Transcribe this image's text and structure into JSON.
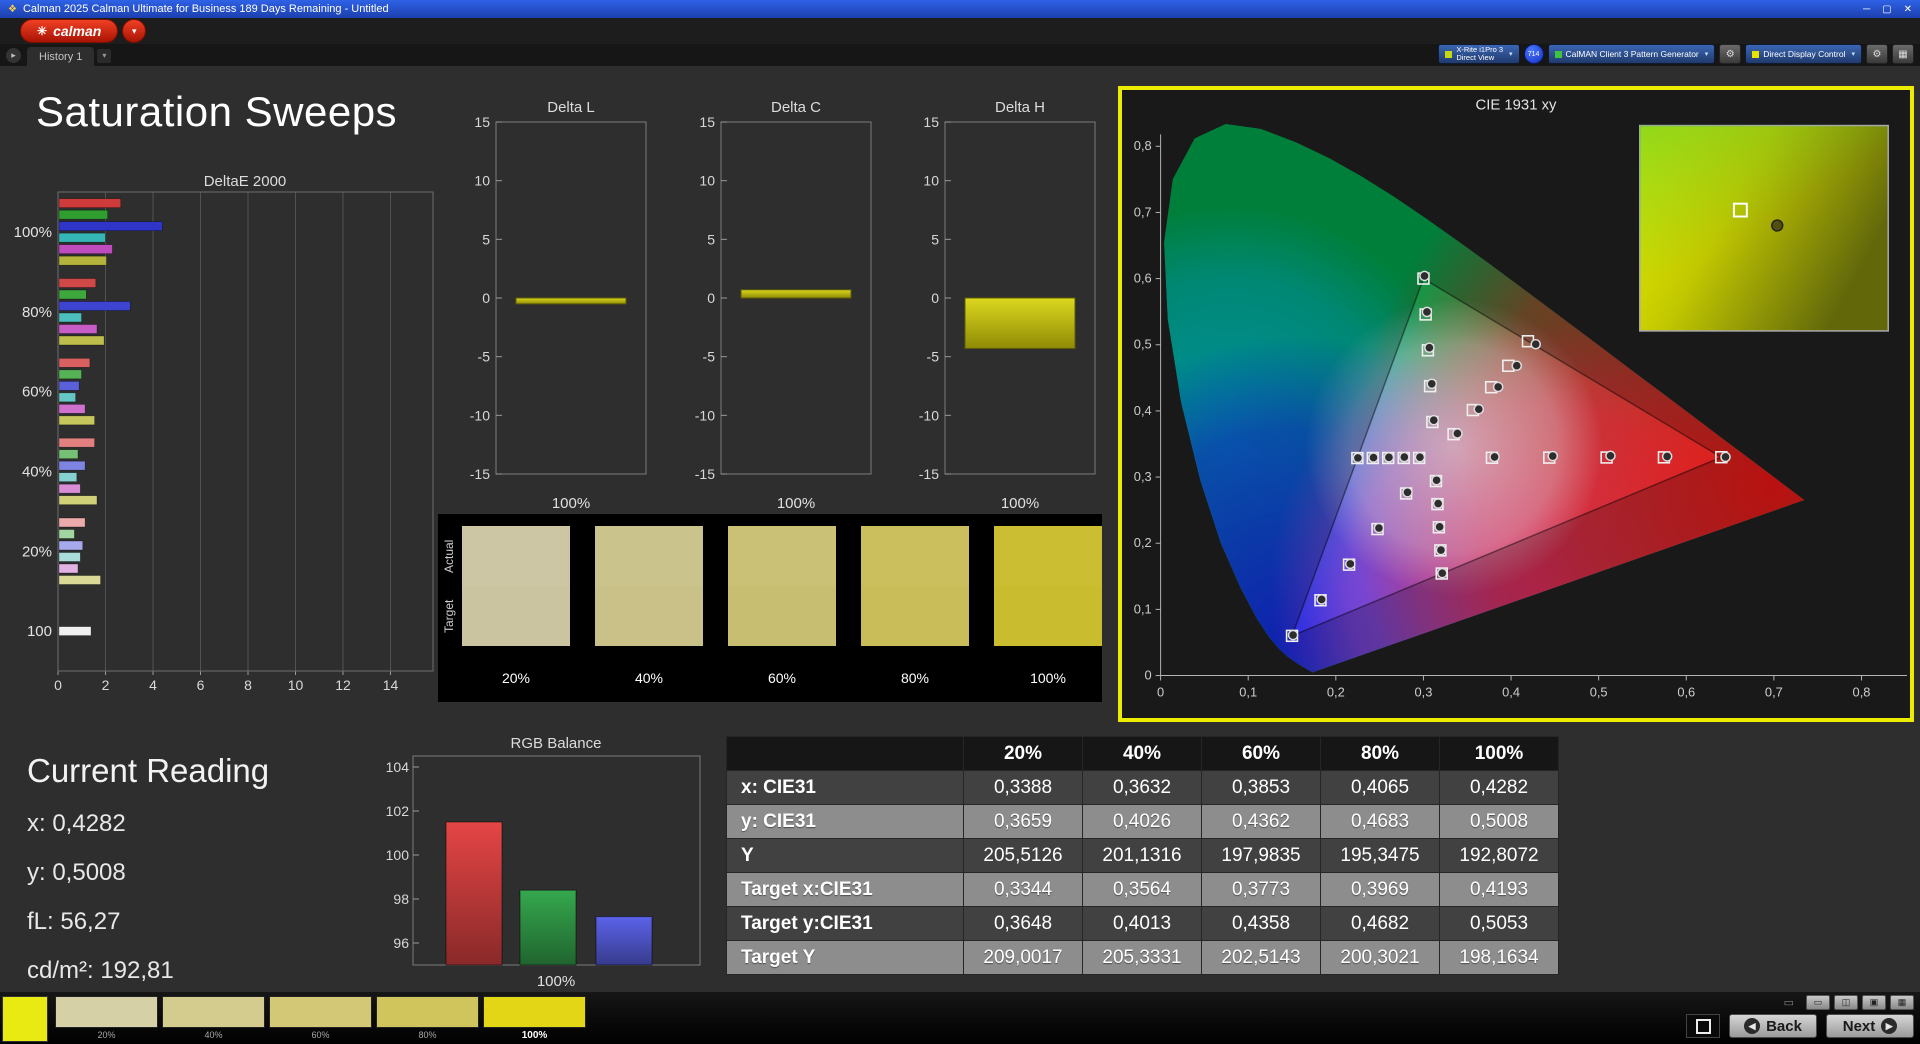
{
  "window": {
    "title": "Calman 2025 Calman Ultimate for Business 189 Days Remaining  - Untitled",
    "minimize": "─",
    "maximize": "▢",
    "close": "✕"
  },
  "logo": {
    "text": "calman",
    "icon": "✳",
    "menu_chevron": "▾"
  },
  "tabs": {
    "history": "History 1",
    "nav_forward": "▸",
    "dropdown": "▾"
  },
  "toolbar": {
    "meter_line1": "X-Rite i1Pro 3",
    "meter_line2": "Direct View",
    "badge": "714",
    "source": "CalMAN Client 3 Pattern Generator",
    "display": "Direct Display Control",
    "gear": "⚙",
    "dropdown": "▾",
    "layout": "▦",
    "meter_status_color": "#c6d80e",
    "pattern_status_color": "#3fc43f",
    "display_status_color": "#e8e400"
  },
  "page_title": "Saturation Sweeps",
  "current_reading": {
    "title": "Current Reading",
    "lines": [
      "x: 0,4282",
      "y: 0,5008",
      "fL: 56,27",
      "cd/m²: 192,81"
    ]
  },
  "swatch_panel": {
    "row_labels": [
      "Actual",
      "Target"
    ],
    "columns": [
      {
        "label": "20%",
        "actual": "#cdc6a4",
        "target": "#cbc4a0"
      },
      {
        "label": "40%",
        "actual": "#cbc38c",
        "target": "#c9c188"
      },
      {
        "label": "60%",
        "actual": "#cac076",
        "target": "#c8be72"
      },
      {
        "label": "80%",
        "actual": "#cabf5c",
        "target": "#c8bd58"
      },
      {
        "label": "100%",
        "actual": "#cbbe32",
        "target": "#c9bc2e"
      }
    ]
  },
  "table": {
    "col_headers": [
      "",
      "20%",
      "40%",
      "60%",
      "80%",
      "100%"
    ],
    "rows": [
      {
        "label": "x: CIE31",
        "values": [
          "0,3388",
          "0,3632",
          "0,3853",
          "0,4065",
          "0,4282"
        ]
      },
      {
        "label": "y: CIE31",
        "values": [
          "0,3659",
          "0,4026",
          "0,4362",
          "0,4683",
          "0,5008"
        ]
      },
      {
        "label": "Y",
        "values": [
          "205,5126",
          "201,1316",
          "197,9835",
          "195,3475",
          "192,8072"
        ]
      },
      {
        "label": "Target x:CIE31",
        "values": [
          "0,3344",
          "0,3564",
          "0,3773",
          "0,3969",
          "0,4193"
        ]
      },
      {
        "label": "Target y:CIE31",
        "values": [
          "0,3648",
          "0,4013",
          "0,4358",
          "0,4682",
          "0,5053"
        ]
      },
      {
        "label": "Target Y",
        "values": [
          "209,0017",
          "205,3331",
          "202,5143",
          "200,3021",
          "198,1634"
        ]
      }
    ]
  },
  "bottom_bar": {
    "current_color": "#e8ea12",
    "back": "Back",
    "next": "Next",
    "back_arrow": "◀",
    "next_arrow": "▶",
    "monitor": "▭",
    "mini_buttons": [
      "▭",
      "◫",
      "▣",
      "▦"
    ],
    "swatches": [
      {
        "label": "20%",
        "color": "#d6d0a6"
      },
      {
        "label": "40%",
        "color": "#d4cc8e"
      },
      {
        "label": "60%",
        "color": "#d2c876"
      },
      {
        "label": "80%",
        "color": "#d0c55c"
      },
      {
        "label": "100%",
        "color": "#e2d616"
      }
    ]
  },
  "colors": {
    "accent_yellow": "#ecec00",
    "logo_red": "#d42814",
    "titlebar_blue": "#2a55d4"
  },
  "chart_data": [
    {
      "id": "deltae2000",
      "type": "bar",
      "orientation": "horizontal",
      "title": "DeltaE 2000",
      "xlim": [
        0,
        15.8
      ],
      "xticks": [
        0,
        2,
        4,
        6,
        8,
        10,
        12,
        14
      ],
      "groups": [
        {
          "label": "100%",
          "bars": [
            {
              "color": "#cf3a3a",
              "value": 2.6
            },
            {
              "color": "#2f9e2f",
              "value": 2.05
            },
            {
              "color": "#2e35c8",
              "value": 4.35
            },
            {
              "color": "#35b6b6",
              "value": 1.95
            },
            {
              "color": "#bf4cbf",
              "value": 2.25
            },
            {
              "color": "#b4b43c",
              "value": 2.0
            }
          ]
        },
        {
          "label": "80%",
          "bars": [
            {
              "color": "#d14848",
              "value": 1.55
            },
            {
              "color": "#3ea83e",
              "value": 1.15
            },
            {
              "color": "#3d44d1",
              "value": 3.0
            },
            {
              "color": "#4cbebe",
              "value": 0.95
            },
            {
              "color": "#c75cc7",
              "value": 1.6
            },
            {
              "color": "#bebe4c",
              "value": 1.9
            }
          ]
        },
        {
          "label": "60%",
          "bars": [
            {
              "color": "#d96060",
              "value": 1.3
            },
            {
              "color": "#55b255",
              "value": 0.95
            },
            {
              "color": "#5a60d9",
              "value": 0.85
            },
            {
              "color": "#66c6c6",
              "value": 0.7
            },
            {
              "color": "#cf70cf",
              "value": 1.1
            },
            {
              "color": "#c6c65e",
              "value": 1.5
            }
          ]
        },
        {
          "label": "40%",
          "bars": [
            {
              "color": "#e28080",
              "value": 1.5
            },
            {
              "color": "#76c076",
              "value": 0.8
            },
            {
              "color": "#7e84e2",
              "value": 1.1
            },
            {
              "color": "#86d0d0",
              "value": 0.75
            },
            {
              "color": "#d78ed7",
              "value": 0.9
            },
            {
              "color": "#d0d078",
              "value": 1.6
            }
          ]
        },
        {
          "label": "20%",
          "bars": [
            {
              "color": "#ecaaaa",
              "value": 1.1
            },
            {
              "color": "#a2d4a2",
              "value": 0.65
            },
            {
              "color": "#a6aaec",
              "value": 1.0
            },
            {
              "color": "#aadcdc",
              "value": 0.9
            },
            {
              "color": "#e2b2e2",
              "value": 0.8
            },
            {
              "color": "#dada96",
              "value": 1.75
            }
          ]
        },
        {
          "label": "100",
          "bars": [
            {
              "color": "#f0f0f0",
              "value": 1.35
            }
          ]
        }
      ]
    },
    {
      "id": "deltaL",
      "type": "bar",
      "title": "Delta L",
      "xlabel": "100%",
      "ylim": [
        -15,
        15
      ],
      "yticks": [
        15,
        10,
        5,
        0,
        -5,
        -10,
        -15
      ],
      "values": [
        -0.5
      ],
      "color": "#c9c31b"
    },
    {
      "id": "deltaC",
      "type": "bar",
      "title": "Delta C",
      "xlabel": "100%",
      "ylim": [
        -15,
        15
      ],
      "yticks": [
        15,
        10,
        5,
        0,
        -5,
        -10,
        -15
      ],
      "values": [
        0.7
      ],
      "color": "#c9c31b"
    },
    {
      "id": "deltaH",
      "type": "bar",
      "title": "Delta H",
      "xlabel": "100%",
      "ylim": [
        -15,
        15
      ],
      "yticks": [
        15,
        10,
        5,
        0,
        -5,
        -10,
        -15
      ],
      "values": [
        -4.3
      ],
      "color": "#c9c31b"
    },
    {
      "id": "rgb_balance",
      "type": "bar",
      "title": "RGB Balance",
      "xlabel": "100%",
      "categories": [
        "Red",
        "Green",
        "Blue"
      ],
      "values": [
        101.5,
        98.4,
        97.2
      ],
      "colors": [
        "#e54545",
        "#35a84e",
        "#5b63ea"
      ],
      "ylim": [
        95,
        104.5
      ],
      "yticks": [
        96,
        98,
        100,
        102,
        104
      ]
    },
    {
      "id": "cie1931",
      "type": "scatter",
      "title": "CIE 1931 xy",
      "xlim": [
        0,
        0.85
      ],
      "ylim": [
        0,
        0.85
      ],
      "xticks": [
        0,
        0.1,
        0.2,
        0.3,
        0.4,
        0.5,
        0.6,
        0.7,
        0.8
      ],
      "yticks": [
        0,
        0.1,
        0.2,
        0.3,
        0.4,
        0.5,
        0.6,
        0.7,
        0.8
      ],
      "white_point": [
        0.3127,
        0.329
      ],
      "gamut_triangle": {
        "red": [
          0.64,
          0.33
        ],
        "green": [
          0.3,
          0.6
        ],
        "blue": [
          0.15,
          0.06
        ]
      },
      "sweeps": [
        {
          "name": "red",
          "targets": [
            [
              0.3782,
              0.3292
            ],
            [
              0.4436,
              0.3294
            ],
            [
              0.5091,
              0.3296
            ],
            [
              0.5745,
              0.3298
            ],
            [
              0.64,
              0.33
            ]
          ],
          "measured": [
            [
              0.3812,
              0.3305
            ],
            [
              0.4476,
              0.3318
            ],
            [
              0.5135,
              0.3322
            ],
            [
              0.5782,
              0.3312
            ],
            [
              0.6448,
              0.3304
            ]
          ]
        },
        {
          "name": "green",
          "targets": [
            [
              0.3102,
              0.3832
            ],
            [
              0.3076,
              0.4374
            ],
            [
              0.3051,
              0.4916
            ],
            [
              0.3025,
              0.5458
            ],
            [
              0.3,
              0.6
            ]
          ],
          "measured": [
            [
              0.3118,
              0.386
            ],
            [
              0.3095,
              0.441
            ],
            [
              0.3068,
              0.4955
            ],
            [
              0.304,
              0.5496
            ],
            [
              0.3012,
              0.604
            ]
          ]
        },
        {
          "name": "blue",
          "targets": [
            [
              0.2802,
              0.2752
            ],
            [
              0.2476,
              0.2214
            ],
            [
              0.2151,
              0.1676
            ],
            [
              0.1825,
              0.1138
            ],
            [
              0.15,
              0.06
            ]
          ],
          "measured": [
            [
              0.2818,
              0.277
            ],
            [
              0.2492,
              0.223
            ],
            [
              0.2165,
              0.1688
            ],
            [
              0.1838,
              0.115
            ],
            [
              0.1512,
              0.0612
            ]
          ]
        },
        {
          "name": "cyan",
          "targets": [
            [
              0.2951,
              0.3289
            ],
            [
              0.2775,
              0.3289
            ],
            [
              0.2598,
              0.3288
            ],
            [
              0.2422,
              0.3288
            ],
            [
              0.2246,
              0.3287
            ]
          ],
          "measured": [
            [
              0.296,
              0.33
            ],
            [
              0.2782,
              0.3302
            ],
            [
              0.2606,
              0.3298
            ],
            [
              0.243,
              0.3295
            ],
            [
              0.2252,
              0.329
            ]
          ]
        },
        {
          "name": "magenta",
          "targets": [
            [
              0.3143,
              0.294
            ],
            [
              0.316,
              0.2591
            ],
            [
              0.3176,
              0.2241
            ],
            [
              0.3193,
              0.1892
            ],
            [
              0.3209,
              0.1542
            ]
          ],
          "measured": [
            [
              0.315,
              0.2952
            ],
            [
              0.3168,
              0.26
            ],
            [
              0.3185,
              0.2248
            ],
            [
              0.32,
              0.1896
            ],
            [
              0.3215,
              0.1548
            ]
          ]
        },
        {
          "name": "yellow",
          "targets": [
            [
              0.3344,
              0.3648
            ],
            [
              0.3564,
              0.4013
            ],
            [
              0.3773,
              0.4358
            ],
            [
              0.3969,
              0.4682
            ],
            [
              0.4193,
              0.5053
            ]
          ],
          "measured": [
            [
              0.3388,
              0.3659
            ],
            [
              0.3632,
              0.4026
            ],
            [
              0.3853,
              0.4362
            ],
            [
              0.4065,
              0.4683
            ],
            [
              0.4282,
              0.5008
            ]
          ]
        }
      ],
      "inset": {
        "x_range": [
          0.395,
          0.455
        ],
        "y_range": [
          0.47,
          0.53
        ]
      }
    }
  ]
}
